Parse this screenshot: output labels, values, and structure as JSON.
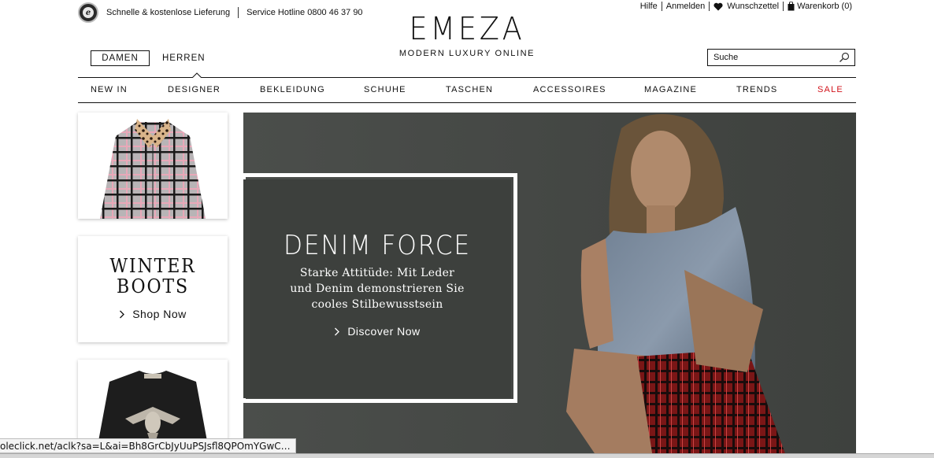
{
  "topbar": {
    "badge_letter": "e",
    "delivery": "Schnelle & kostenlose Lieferung",
    "hotline": "Service Hotline 0800 46 37 90",
    "links": {
      "help": "Hilfe",
      "login": "Anmelden",
      "wishlist": "Wunschzettel",
      "cart": "Warenkorb (0)"
    }
  },
  "logo": {
    "title": "EMEZA",
    "subtitle": "MODERN LUXURY ONLINE"
  },
  "gender": {
    "active": "DAMEN",
    "inactive": "HERREN"
  },
  "search": {
    "placeholder": "Suche"
  },
  "nav": {
    "items": [
      "NEW IN",
      "DESIGNER",
      "BEKLEIDUNG",
      "SCHUHE",
      "TASCHEN",
      "ACCESSOIRES",
      "MAGAZINE",
      "TRENDS",
      "SALE"
    ]
  },
  "tiles": {
    "boots_line1": "WINTER",
    "boots_line2": "BOOTS",
    "boots_cta": "Shop Now"
  },
  "hero": {
    "title": "DENIM FORCE",
    "sub_line1": "Starke Attitüde: Mit Leder",
    "sub_line2": "und Denim demonstrieren Sie",
    "sub_line3": "cooles Stilbewusstsein",
    "cta": "Discover Now"
  },
  "status": {
    "url": "oleclick.net/aclk?sa=L&ai=Bh8GrCbJyUuPSJsfl8QPOmYGwC…"
  },
  "colors": {
    "sale": "#d2141c",
    "hero_bg": "#4f524f",
    "hero_box": "#3d403d"
  }
}
